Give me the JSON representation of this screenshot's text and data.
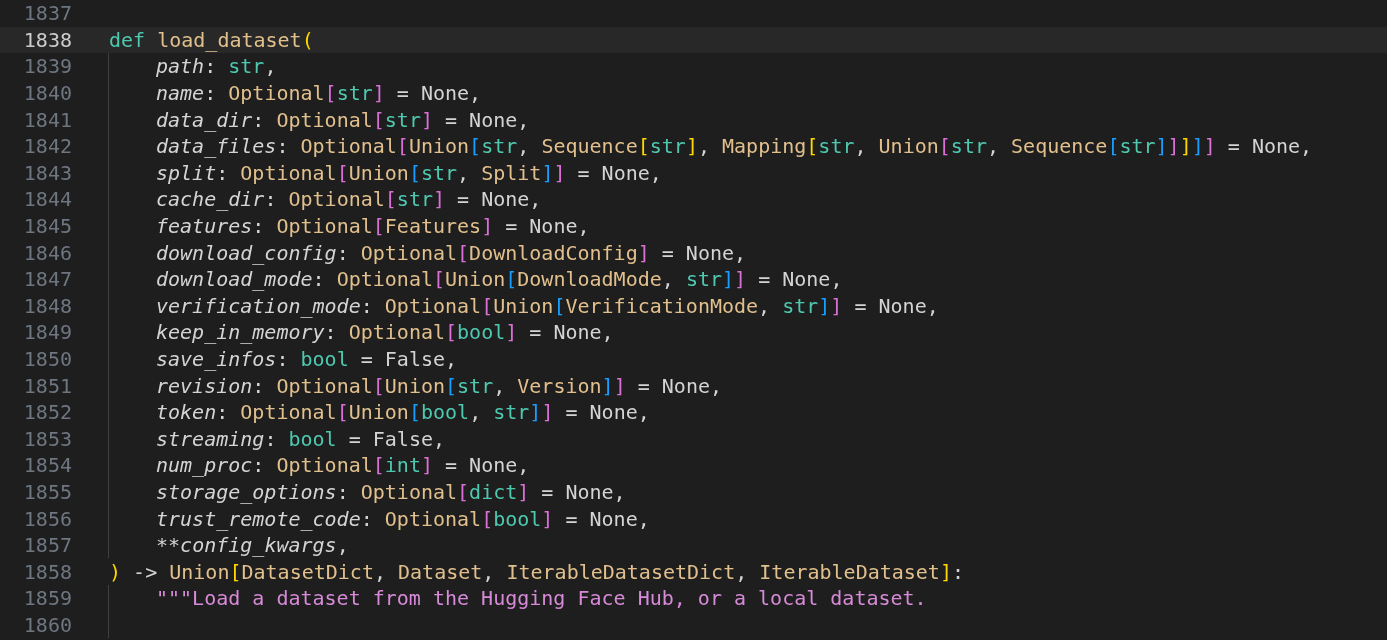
{
  "editor": {
    "lines": [
      {
        "number": "1837",
        "current": false,
        "guide": false
      },
      {
        "number": "1838",
        "current": true,
        "guide": false,
        "tokens": [
          {
            "text": "def ",
            "kind": "kw"
          },
          {
            "text": "load_dataset",
            "kind": "fn"
          },
          {
            "text": "(",
            "kind": "br",
            "color": "#ffd700"
          }
        ]
      },
      {
        "number": "1839",
        "current": false,
        "guide": true,
        "tokens": [
          {
            "text": "path",
            "kind": "param"
          },
          {
            "text": ": ",
            "kind": "p"
          },
          {
            "text": "str",
            "kind": "bi"
          },
          {
            "text": ",",
            "kind": "p"
          }
        ]
      },
      {
        "number": "1840",
        "current": false,
        "guide": true,
        "tokens": [
          {
            "text": "name",
            "kind": "param"
          },
          {
            "text": ": ",
            "kind": "p"
          },
          {
            "text": "Optional",
            "kind": "cls"
          },
          {
            "text": "[",
            "kind": "br",
            "color": "#da70d6"
          },
          {
            "text": "str",
            "kind": "bi"
          },
          {
            "text": "]",
            "kind": "br",
            "color": "#da70d6"
          },
          {
            "text": " = None,",
            "kind": "p"
          }
        ]
      },
      {
        "number": "1841",
        "current": false,
        "guide": true,
        "tokens": [
          {
            "text": "data_dir",
            "kind": "param"
          },
          {
            "text": ": ",
            "kind": "p"
          },
          {
            "text": "Optional",
            "kind": "cls"
          },
          {
            "text": "[",
            "kind": "br",
            "color": "#da70d6"
          },
          {
            "text": "str",
            "kind": "bi"
          },
          {
            "text": "]",
            "kind": "br",
            "color": "#da70d6"
          },
          {
            "text": " = None,",
            "kind": "p"
          }
        ]
      },
      {
        "number": "1842",
        "current": false,
        "guide": true,
        "tokens": [
          {
            "text": "data_files",
            "kind": "param"
          },
          {
            "text": ": ",
            "kind": "p"
          },
          {
            "text": "Optional",
            "kind": "cls"
          },
          {
            "text": "[",
            "kind": "br",
            "color": "#da70d6"
          },
          {
            "text": "Union",
            "kind": "cls"
          },
          {
            "text": "[",
            "kind": "br",
            "color": "#179fff"
          },
          {
            "text": "str",
            "kind": "bi"
          },
          {
            "text": ", ",
            "kind": "p"
          },
          {
            "text": "Sequence",
            "kind": "cls"
          },
          {
            "text": "[",
            "kind": "br",
            "color": "#ffd700"
          },
          {
            "text": "str",
            "kind": "bi"
          },
          {
            "text": "]",
            "kind": "br",
            "color": "#ffd700"
          },
          {
            "text": ", ",
            "kind": "p"
          },
          {
            "text": "Mapping",
            "kind": "cls"
          },
          {
            "text": "[",
            "kind": "br",
            "color": "#ffd700"
          },
          {
            "text": "str",
            "kind": "bi"
          },
          {
            "text": ", ",
            "kind": "p"
          },
          {
            "text": "Union",
            "kind": "cls"
          },
          {
            "text": "[",
            "kind": "br",
            "color": "#da70d6"
          },
          {
            "text": "str",
            "kind": "bi"
          },
          {
            "text": ", ",
            "kind": "p"
          },
          {
            "text": "Sequence",
            "kind": "cls"
          },
          {
            "text": "[",
            "kind": "br",
            "color": "#179fff"
          },
          {
            "text": "str",
            "kind": "bi"
          },
          {
            "text": "]",
            "kind": "br",
            "color": "#179fff"
          },
          {
            "text": "]",
            "kind": "br",
            "color": "#da70d6"
          },
          {
            "text": "]",
            "kind": "br",
            "color": "#ffd700"
          },
          {
            "text": "]",
            "kind": "br",
            "color": "#179fff"
          },
          {
            "text": "]",
            "kind": "br",
            "color": "#da70d6"
          },
          {
            "text": " = None,",
            "kind": "p"
          }
        ]
      },
      {
        "number": "1843",
        "current": false,
        "guide": true,
        "tokens": [
          {
            "text": "split",
            "kind": "param"
          },
          {
            "text": ": ",
            "kind": "p"
          },
          {
            "text": "Optional",
            "kind": "cls"
          },
          {
            "text": "[",
            "kind": "br",
            "color": "#da70d6"
          },
          {
            "text": "Union",
            "kind": "cls"
          },
          {
            "text": "[",
            "kind": "br",
            "color": "#179fff"
          },
          {
            "text": "str",
            "kind": "bi"
          },
          {
            "text": ", ",
            "kind": "p"
          },
          {
            "text": "Split",
            "kind": "cls"
          },
          {
            "text": "]",
            "kind": "br",
            "color": "#179fff"
          },
          {
            "text": "]",
            "kind": "br",
            "color": "#da70d6"
          },
          {
            "text": " = None,",
            "kind": "p"
          }
        ]
      },
      {
        "number": "1844",
        "current": false,
        "guide": true,
        "tokens": [
          {
            "text": "cache_dir",
            "kind": "param"
          },
          {
            "text": ": ",
            "kind": "p"
          },
          {
            "text": "Optional",
            "kind": "cls"
          },
          {
            "text": "[",
            "kind": "br",
            "color": "#da70d6"
          },
          {
            "text": "str",
            "kind": "bi"
          },
          {
            "text": "]",
            "kind": "br",
            "color": "#da70d6"
          },
          {
            "text": " = None,",
            "kind": "p"
          }
        ]
      },
      {
        "number": "1845",
        "current": false,
        "guide": true,
        "tokens": [
          {
            "text": "features",
            "kind": "param"
          },
          {
            "text": ": ",
            "kind": "p"
          },
          {
            "text": "Optional",
            "kind": "cls"
          },
          {
            "text": "[",
            "kind": "br",
            "color": "#da70d6"
          },
          {
            "text": "Features",
            "kind": "cls"
          },
          {
            "text": "]",
            "kind": "br",
            "color": "#da70d6"
          },
          {
            "text": " = None,",
            "kind": "p"
          }
        ]
      },
      {
        "number": "1846",
        "current": false,
        "guide": true,
        "tokens": [
          {
            "text": "download_config",
            "kind": "param"
          },
          {
            "text": ": ",
            "kind": "p"
          },
          {
            "text": "Optional",
            "kind": "cls"
          },
          {
            "text": "[",
            "kind": "br",
            "color": "#da70d6"
          },
          {
            "text": "DownloadConfig",
            "kind": "cls"
          },
          {
            "text": "]",
            "kind": "br",
            "color": "#da70d6"
          },
          {
            "text": " = None,",
            "kind": "p"
          }
        ]
      },
      {
        "number": "1847",
        "current": false,
        "guide": true,
        "tokens": [
          {
            "text": "download_mode",
            "kind": "param"
          },
          {
            "text": ": ",
            "kind": "p"
          },
          {
            "text": "Optional",
            "kind": "cls"
          },
          {
            "text": "[",
            "kind": "br",
            "color": "#da70d6"
          },
          {
            "text": "Union",
            "kind": "cls"
          },
          {
            "text": "[",
            "kind": "br",
            "color": "#179fff"
          },
          {
            "text": "DownloadMode",
            "kind": "cls"
          },
          {
            "text": ", ",
            "kind": "p"
          },
          {
            "text": "str",
            "kind": "bi"
          },
          {
            "text": "]",
            "kind": "br",
            "color": "#179fff"
          },
          {
            "text": "]",
            "kind": "br",
            "color": "#da70d6"
          },
          {
            "text": " = None,",
            "kind": "p"
          }
        ]
      },
      {
        "number": "1848",
        "current": false,
        "guide": true,
        "tokens": [
          {
            "text": "verification_mode",
            "kind": "param"
          },
          {
            "text": ": ",
            "kind": "p"
          },
          {
            "text": "Optional",
            "kind": "cls"
          },
          {
            "text": "[",
            "kind": "br",
            "color": "#da70d6"
          },
          {
            "text": "Union",
            "kind": "cls"
          },
          {
            "text": "[",
            "kind": "br",
            "color": "#179fff"
          },
          {
            "text": "VerificationMode",
            "kind": "cls"
          },
          {
            "text": ", ",
            "kind": "p"
          },
          {
            "text": "str",
            "kind": "bi"
          },
          {
            "text": "]",
            "kind": "br",
            "color": "#179fff"
          },
          {
            "text": "]",
            "kind": "br",
            "color": "#da70d6"
          },
          {
            "text": " = None,",
            "kind": "p"
          }
        ]
      },
      {
        "number": "1849",
        "current": false,
        "guide": true,
        "tokens": [
          {
            "text": "keep_in_memory",
            "kind": "param"
          },
          {
            "text": ": ",
            "kind": "p"
          },
          {
            "text": "Optional",
            "kind": "cls"
          },
          {
            "text": "[",
            "kind": "br",
            "color": "#da70d6"
          },
          {
            "text": "bool",
            "kind": "bi"
          },
          {
            "text": "]",
            "kind": "br",
            "color": "#da70d6"
          },
          {
            "text": " = None,",
            "kind": "p"
          }
        ]
      },
      {
        "number": "1850",
        "current": false,
        "guide": true,
        "tokens": [
          {
            "text": "save_infos",
            "kind": "param"
          },
          {
            "text": ": ",
            "kind": "p"
          },
          {
            "text": "bool",
            "kind": "bi"
          },
          {
            "text": " = False,",
            "kind": "p"
          }
        ]
      },
      {
        "number": "1851",
        "current": false,
        "guide": true,
        "tokens": [
          {
            "text": "revision",
            "kind": "param"
          },
          {
            "text": ": ",
            "kind": "p"
          },
          {
            "text": "Optional",
            "kind": "cls"
          },
          {
            "text": "[",
            "kind": "br",
            "color": "#da70d6"
          },
          {
            "text": "Union",
            "kind": "cls"
          },
          {
            "text": "[",
            "kind": "br",
            "color": "#179fff"
          },
          {
            "text": "str",
            "kind": "bi"
          },
          {
            "text": ", ",
            "kind": "p"
          },
          {
            "text": "Version",
            "kind": "cls"
          },
          {
            "text": "]",
            "kind": "br",
            "color": "#179fff"
          },
          {
            "text": "]",
            "kind": "br",
            "color": "#da70d6"
          },
          {
            "text": " = None,",
            "kind": "p"
          }
        ]
      },
      {
        "number": "1852",
        "current": false,
        "guide": true,
        "tokens": [
          {
            "text": "token",
            "kind": "param"
          },
          {
            "text": ": ",
            "kind": "p"
          },
          {
            "text": "Optional",
            "kind": "cls"
          },
          {
            "text": "[",
            "kind": "br",
            "color": "#da70d6"
          },
          {
            "text": "Union",
            "kind": "cls"
          },
          {
            "text": "[",
            "kind": "br",
            "color": "#179fff"
          },
          {
            "text": "bool",
            "kind": "bi"
          },
          {
            "text": ", ",
            "kind": "p"
          },
          {
            "text": "str",
            "kind": "bi"
          },
          {
            "text": "]",
            "kind": "br",
            "color": "#179fff"
          },
          {
            "text": "]",
            "kind": "br",
            "color": "#da70d6"
          },
          {
            "text": " = None,",
            "kind": "p"
          }
        ]
      },
      {
        "number": "1853",
        "current": false,
        "guide": true,
        "tokens": [
          {
            "text": "streaming",
            "kind": "param"
          },
          {
            "text": ": ",
            "kind": "p"
          },
          {
            "text": "bool",
            "kind": "bi"
          },
          {
            "text": " = False,",
            "kind": "p"
          }
        ]
      },
      {
        "number": "1854",
        "current": false,
        "guide": true,
        "tokens": [
          {
            "text": "num_proc",
            "kind": "param"
          },
          {
            "text": ": ",
            "kind": "p"
          },
          {
            "text": "Optional",
            "kind": "cls"
          },
          {
            "text": "[",
            "kind": "br",
            "color": "#da70d6"
          },
          {
            "text": "int",
            "kind": "bi"
          },
          {
            "text": "]",
            "kind": "br",
            "color": "#da70d6"
          },
          {
            "text": " = None,",
            "kind": "p"
          }
        ]
      },
      {
        "number": "1855",
        "current": false,
        "guide": true,
        "tokens": [
          {
            "text": "storage_options",
            "kind": "param"
          },
          {
            "text": ": ",
            "kind": "p"
          },
          {
            "text": "Optional",
            "kind": "cls"
          },
          {
            "text": "[",
            "kind": "br",
            "color": "#da70d6"
          },
          {
            "text": "dict",
            "kind": "bi"
          },
          {
            "text": "]",
            "kind": "br",
            "color": "#da70d6"
          },
          {
            "text": " = None,",
            "kind": "p"
          }
        ]
      },
      {
        "number": "1856",
        "current": false,
        "guide": true,
        "tokens": [
          {
            "text": "trust_remote_code",
            "kind": "param"
          },
          {
            "text": ": ",
            "kind": "p"
          },
          {
            "text": "Optional",
            "kind": "cls"
          },
          {
            "text": "[",
            "kind": "br",
            "color": "#da70d6"
          },
          {
            "text": "bool",
            "kind": "bi"
          },
          {
            "text": "]",
            "kind": "br",
            "color": "#da70d6"
          },
          {
            "text": " = None,",
            "kind": "p"
          }
        ]
      },
      {
        "number": "1857",
        "current": false,
        "guide": true,
        "tokens": [
          {
            "text": "**",
            "kind": "p"
          },
          {
            "text": "config_kwargs",
            "kind": "param"
          },
          {
            "text": ",",
            "kind": "p"
          }
        ]
      },
      {
        "number": "1858",
        "current": false,
        "guide": false,
        "tokens": [
          {
            "text": ")",
            "kind": "br",
            "color": "#ffd700"
          },
          {
            "text": " -> ",
            "kind": "p"
          },
          {
            "text": "Union",
            "kind": "cls"
          },
          {
            "text": "[",
            "kind": "br",
            "color": "#ffd700"
          },
          {
            "text": "DatasetDict",
            "kind": "cls"
          },
          {
            "text": ", ",
            "kind": "p"
          },
          {
            "text": "Dataset",
            "kind": "cls"
          },
          {
            "text": ", ",
            "kind": "p"
          },
          {
            "text": "IterableDatasetDict",
            "kind": "cls"
          },
          {
            "text": ", ",
            "kind": "p"
          },
          {
            "text": "IterableDataset",
            "kind": "cls"
          },
          {
            "text": "]",
            "kind": "br",
            "color": "#ffd700"
          },
          {
            "text": ":",
            "kind": "p"
          }
        ]
      },
      {
        "number": "1859",
        "current": false,
        "guide": true,
        "tokens": [
          {
            "text": "\"\"\"Load a dataset from the Hugging Face Hub, or a local dataset.",
            "kind": "str"
          }
        ]
      },
      {
        "number": "1860",
        "current": false,
        "guide": true
      }
    ]
  }
}
